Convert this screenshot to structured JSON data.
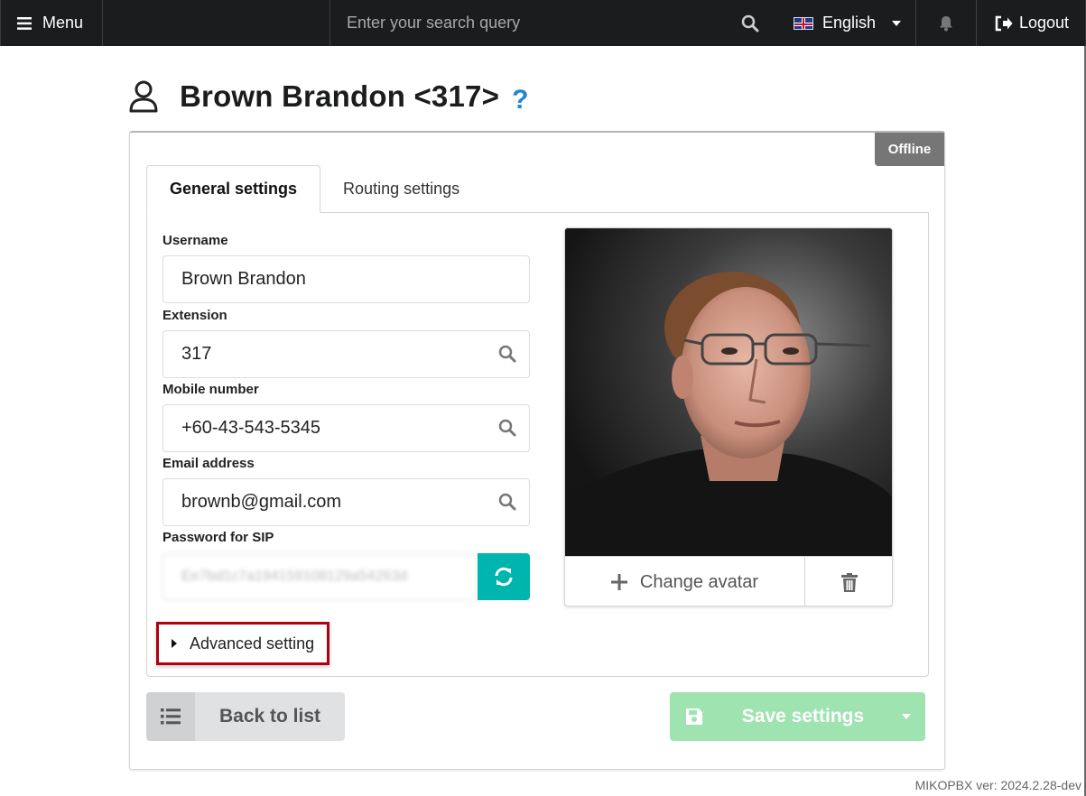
{
  "topbar": {
    "menu_label": "Menu",
    "search_placeholder": "Enter your search query",
    "language": "English",
    "logout_label": "Logout"
  },
  "page": {
    "title": "Brown Brandon <317>",
    "help": "?"
  },
  "status": "Offline",
  "tabs": [
    {
      "label": "General settings",
      "active": true
    },
    {
      "label": "Routing settings",
      "active": false
    }
  ],
  "form": {
    "username_label": "Username",
    "username_value": "Brown Brandon",
    "extension_label": "Extension",
    "extension_value": "317",
    "mobile_label": "Mobile number",
    "mobile_value": "+60-43-543-5345",
    "email_label": "Email address",
    "email_value": "brownb@gmail.com",
    "password_label": "Password for SIP",
    "password_value": "Ee7bd1c7a194159108129a54263d"
  },
  "advanced_label": "Advanced setting",
  "avatar": {
    "change_label": "Change avatar"
  },
  "buttons": {
    "back_label": "Back to list",
    "save_label": "Save settings"
  },
  "version": "MIKOPBX ver: 2024.2.28-dev",
  "colors": {
    "topbar": "#1b1c1d",
    "teal": "#00b5ad",
    "save_green": "#9ee3b0",
    "offline_grey": "#767676",
    "highlight_red": "#b0000d"
  }
}
